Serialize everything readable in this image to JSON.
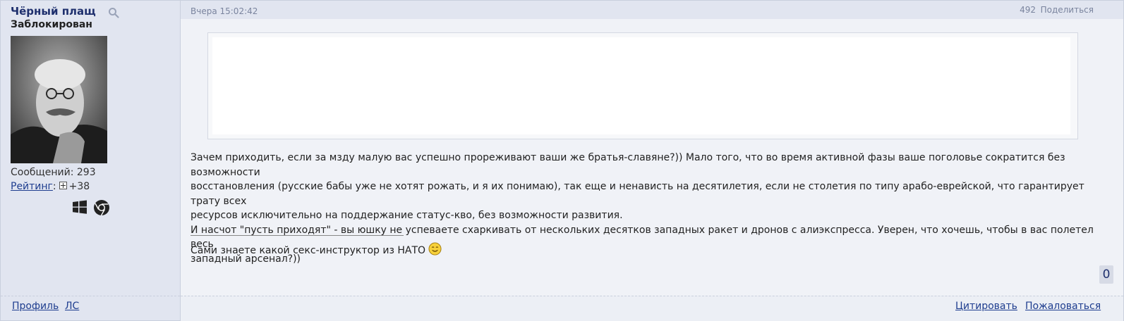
{
  "author": {
    "name": "Чёрный плащ",
    "status": "Заблокирован",
    "posts_label": "Сообщений:",
    "posts_count": "293",
    "rating_label": "Рейтинг",
    "rating_value": "+38",
    "os_icons": [
      "windows-icon",
      "chrome-icon"
    ]
  },
  "post": {
    "date": "Вчера 15:02:42",
    "number": "492",
    "share_label": "Поделиться",
    "text": [
      "Зачем приходить, если за мзду малую вас успешно прореживают ваши же братья-славяне?)) Мало того, что во время активной фазы ваше поголовье сократится без возможности",
      "восстановления (русские бабы уже не хотят рожать, и я их понимаю), так еще и ненависть на десятилетия, если не столетия по типу арабо-еврейской, что гарантирует трату всех",
      "ресурсов исключительно на поддержание статус-кво, без возможности развития.",
      "И насчот \"пусть приходят\" - вы юшку не успеваете схаркивать от нескольких десятков западных ракет и дронов с алиэкспресса. Уверен, что хочешь, чтобы в вас полетел весь",
      "западный арсенал?))"
    ],
    "signature": "Сами знаете какой секс-инструктор из НАТО",
    "likes": "0"
  },
  "actions": {
    "profile": "Профиль",
    "pm": "ЛС",
    "quote": "Цитировать",
    "report": "Пожаловаться"
  },
  "colors": {
    "sidebar_bg": "#e1e5f0",
    "post_bg": "#f0f2f7",
    "username": "#1e2f6d",
    "link": "#1e3d8f"
  }
}
